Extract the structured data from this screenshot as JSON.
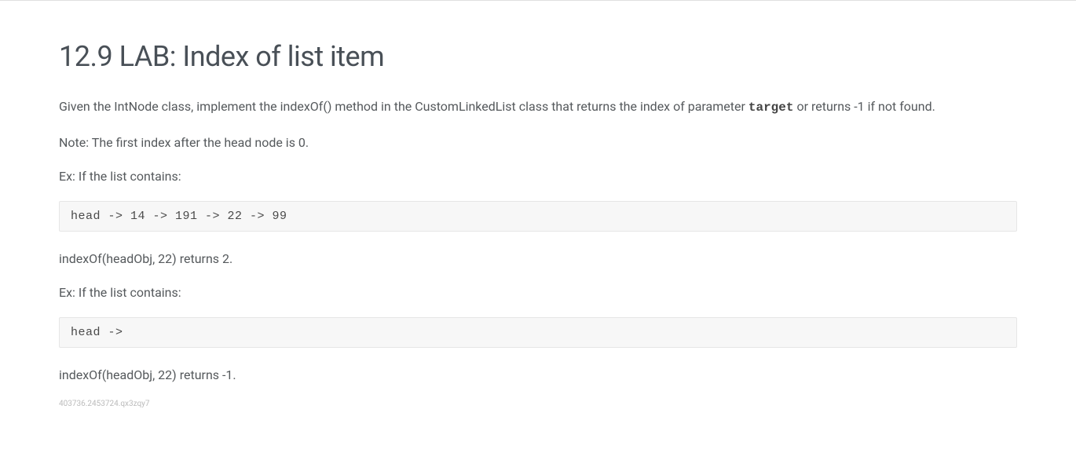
{
  "title": "12.9 LAB: Index of list item",
  "para1_pre": "Given the IntNode class, implement the indexOf() method in the CustomLinkedList class that returns the index of parameter ",
  "para1_code": "target",
  "para1_post": " or returns -1 if not found.",
  "para2": "Note: The first index after the head node is 0.",
  "para3": "Ex: If the list contains:",
  "code1": "head -> 14 -> 191 -> 22 -> 99",
  "para4": "indexOf(headObj, 22) returns 2.",
  "para5": "Ex: If the list contains:",
  "code2": "head -> ",
  "para6": "indexOf(headObj, 22) returns -1.",
  "footer_id": "403736.2453724.qx3zqy7"
}
